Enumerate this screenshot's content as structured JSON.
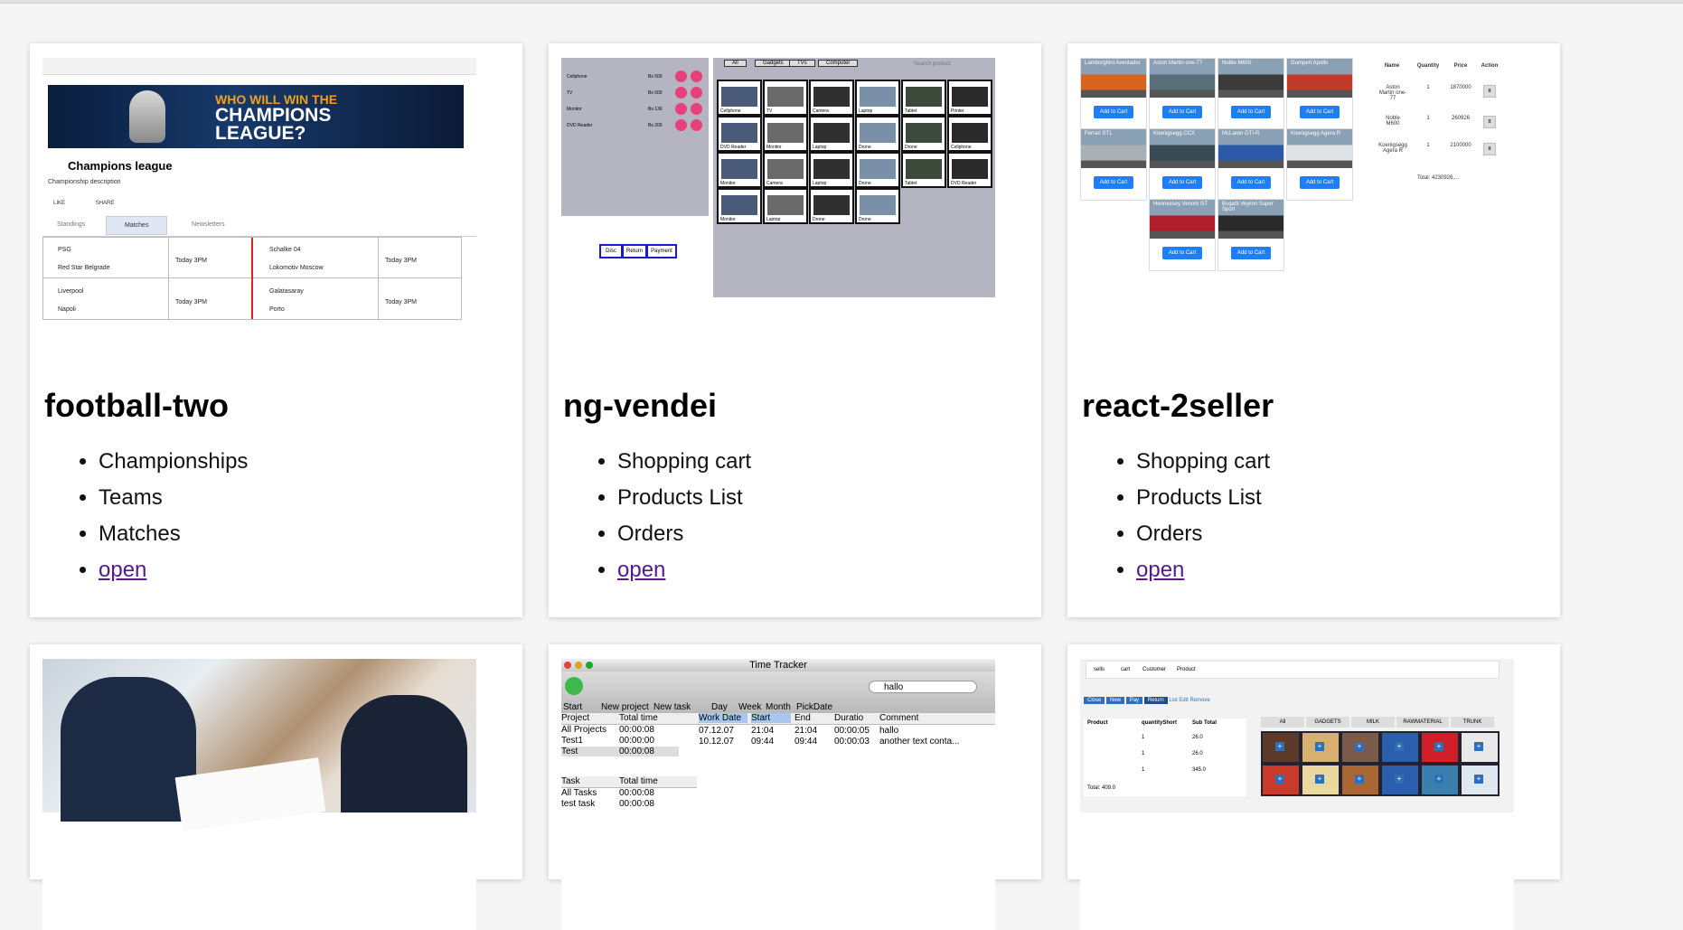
{
  "cards": [
    {
      "title": "football-two",
      "features": [
        "Championships",
        "Teams",
        "Matches"
      ],
      "link": "open",
      "thumb": {
        "banner_line1": "WHO WILL WIN THE",
        "banner_line2": "CHAMPIONS LEAGUE?",
        "heading": "Champions league",
        "description": "Championship description",
        "btn_a": "LIKE",
        "btn_b": "SHARE",
        "tabs": [
          "Standings",
          "Matches",
          "Newsletters"
        ],
        "matches": [
          {
            "home": "PSG",
            "away": "Red Star Belgrade",
            "when": "Today 3PM"
          },
          {
            "home": "Schalke 04",
            "away": "Lokomotiv Moscow",
            "when": "Today 3PM"
          },
          {
            "home": "Liverpool",
            "away": "Napoli",
            "when": "Today 3PM"
          },
          {
            "home": "Galatasaray",
            "away": "Porto",
            "when": "Today 3PM"
          }
        ]
      }
    },
    {
      "title": "ng-vendei",
      "features": [
        "Shopping cart",
        "Products List",
        "Orders"
      ],
      "link": "open",
      "thumb": {
        "tabs": [
          "All",
          "Gadgets",
          "TVs",
          "Computer"
        ],
        "search_placeholder": "Search product",
        "cart": [
          {
            "name": "Cellphone",
            "price": "Bs 500"
          },
          {
            "name": "TV",
            "price": "Bs 600"
          },
          {
            "name": "Monitor",
            "price": "Bs 130"
          },
          {
            "name": "DVD Reader",
            "price": "Bs 200"
          }
        ],
        "actions": [
          "Disc",
          "Return",
          "Payment"
        ],
        "products": [
          "Cellphone",
          "TV",
          "Camera",
          "Laptop",
          "Tablet",
          "Printer",
          "DVD Reader",
          "Monitor",
          "Laptop",
          "Drone",
          "Drone",
          "Cellphone",
          "Monitor",
          "Camera",
          "Laptop",
          "Drone",
          "Tablet",
          "DVD Reader",
          "Monitor",
          "Laptop",
          "Drone",
          "Drone"
        ]
      }
    },
    {
      "title": "react-2seller",
      "features": [
        "Shopping cart",
        "Products List",
        "Orders"
      ],
      "link": "open",
      "thumb": {
        "add_label": "Add to Cart",
        "cars": [
          "Lamborghini Aventador",
          "Aston Martin one-77",
          "Noble M600",
          "Gumpert Apollo",
          "Ferrari ST1",
          "Koenigsegg CCX",
          "McLaren GTI-R",
          "Koenigsegg Agera R",
          "Hennessey Venom GT",
          "Bugatti Veyron Super Sport"
        ],
        "columns": [
          "Name",
          "Quantity",
          "Price",
          "Action"
        ],
        "rows": [
          {
            "name": "Aston Martin one-77",
            "qty": "1",
            "price": "1870000"
          },
          {
            "name": "Noble M600",
            "qty": "1",
            "price": "260926"
          },
          {
            "name": "Koenigsegg Agera R",
            "qty": "1",
            "price": "2100000"
          }
        ],
        "total": "Total: 4230926,..."
      }
    },
    {
      "title": "",
      "features": [],
      "link": ""
    },
    {
      "title": "",
      "features": [],
      "link": "",
      "thumb": {
        "window_title": "Time Tracker",
        "tools": [
          "Start",
          "New project",
          "New task",
          "Day",
          "Week",
          "Month",
          "PickDate"
        ],
        "search": "hallo",
        "project_cols": [
          "Project",
          "Total time"
        ],
        "projects": [
          [
            "All Projects",
            "00:00:08"
          ],
          [
            "Test1",
            "00:00:00"
          ],
          [
            "Test",
            "00:00:08"
          ]
        ],
        "task_cols": [
          "Task",
          "Total time"
        ],
        "tasks": [
          [
            "All Tasks",
            "00:00:08"
          ],
          [
            "test task",
            "00:00:08"
          ]
        ],
        "entry_cols": [
          "Work Date",
          "Start",
          "End",
          "Duratio",
          "Comment"
        ],
        "entries": [
          [
            "07.12.07",
            "21:04",
            "21:04",
            "00:00:05",
            "hallo"
          ],
          [
            "10.12.07",
            "09:44",
            "09:44",
            "00:00:03",
            "another text conta..."
          ]
        ]
      }
    },
    {
      "title": "",
      "features": [],
      "link": "",
      "thumb": {
        "nav": [
          "sells",
          "cart",
          "Customer",
          "Product"
        ],
        "actions": [
          "Close",
          "New",
          "Pay",
          "Return",
          "List",
          "Edit",
          "Remove"
        ],
        "tabs": [
          "All",
          "GADGETS",
          "MILK",
          "RAWMATERIAL",
          "TRUNK"
        ],
        "cols": [
          "Product",
          "quantityShort",
          "Sub Total"
        ],
        "rows": [
          [
            "1",
            "26.0"
          ],
          [
            "1",
            "26.0"
          ],
          [
            "1",
            "345.0"
          ]
        ],
        "total": "Total: 409.0"
      }
    }
  ]
}
